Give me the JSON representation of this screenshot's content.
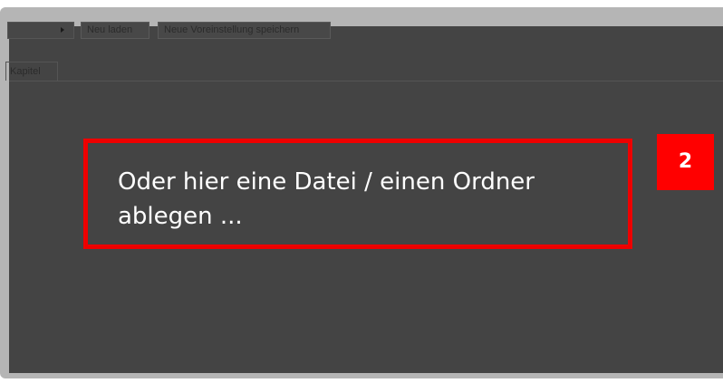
{
  "toolbar": {
    "dropdown_value": "",
    "reload_label": "Neu laden",
    "save_preset_label": "Neue Voreinstellung speichern"
  },
  "tabs": [
    {
      "label": "Kapitel"
    }
  ],
  "drop_zone": {
    "text": "Oder hier eine Datei / einen Ordner\nablegen ..."
  },
  "annotation": {
    "step_number": "2"
  },
  "colors": {
    "overlay": "#444444",
    "frame": "#b5b5b5",
    "highlight_border": "#ee0000",
    "badge": "#ff0000",
    "text": "#ffffff"
  },
  "icons": {
    "dropdown": "chevron-right-icon"
  }
}
